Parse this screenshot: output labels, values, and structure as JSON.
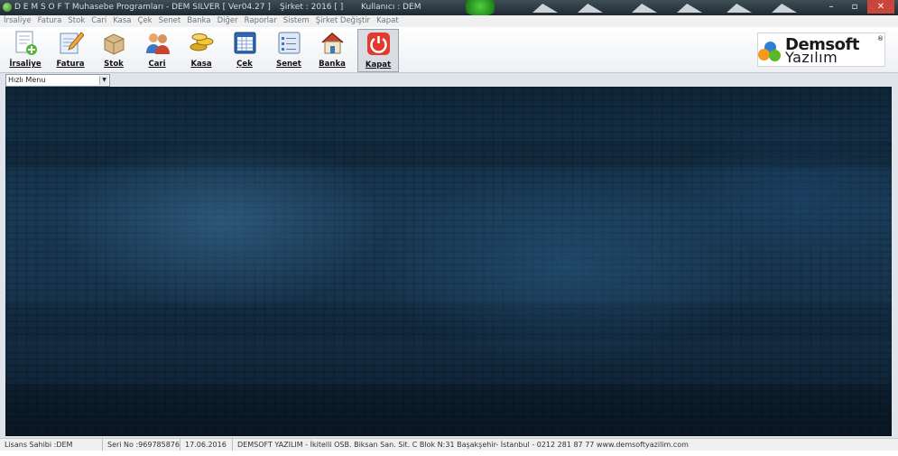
{
  "titlebar": {
    "title": "D E M S O F T  Muhasebe Programları - DEM SILVER [ Ver04.27 ]",
    "company": "Şirket : 2016  [ ]",
    "user": "Kullanıcı : DEM"
  },
  "window_controls": {
    "minimize": "–",
    "maximize": "▫",
    "close": "✕"
  },
  "menu": [
    "İrsaliye",
    "Fatura",
    "Stok",
    "Cari",
    "Kasa",
    "Çek",
    "Senet",
    "Banka",
    "Diğer",
    "Raporlar",
    "Sistem",
    "Şirket Değiştir",
    "Kapat"
  ],
  "toolbar": [
    {
      "label": "İrsaliye",
      "icon": "document-add-icon"
    },
    {
      "label": "Fatura",
      "icon": "pencil-document-icon"
    },
    {
      "label": "Stok",
      "icon": "box-icon"
    },
    {
      "label": "Cari",
      "icon": "users-icon"
    },
    {
      "label": "Kasa",
      "icon": "coins-icon"
    },
    {
      "label": "Çek",
      "icon": "calendar-icon"
    },
    {
      "label": "Senet",
      "icon": "form-icon"
    },
    {
      "label": "Banka",
      "icon": "house-icon"
    },
    {
      "label": "Kapat",
      "icon": "power-icon"
    }
  ],
  "logo": {
    "name": "Demsoft",
    "sub": "Yazılım",
    "mark": "®"
  },
  "quick_menu": {
    "value": "Hızlı Menu"
  },
  "status": {
    "license": "Lisans Sahibi :DEM",
    "serial": "Seri No :969785876",
    "date": "17.06.2016",
    "info": "DEMSOFT YAZILIM - İkitelli OSB. Biksan San. Sit. C Blok N:31 Başakşehir- İstanbul  -  0212 281 87 77  www.demsoftyazilim.com"
  },
  "colors": {
    "titlebar": "#26323b",
    "desktop": "#17344d",
    "kapat_icon": "#e23a2e",
    "accent_blue": "#2f7fd6"
  }
}
